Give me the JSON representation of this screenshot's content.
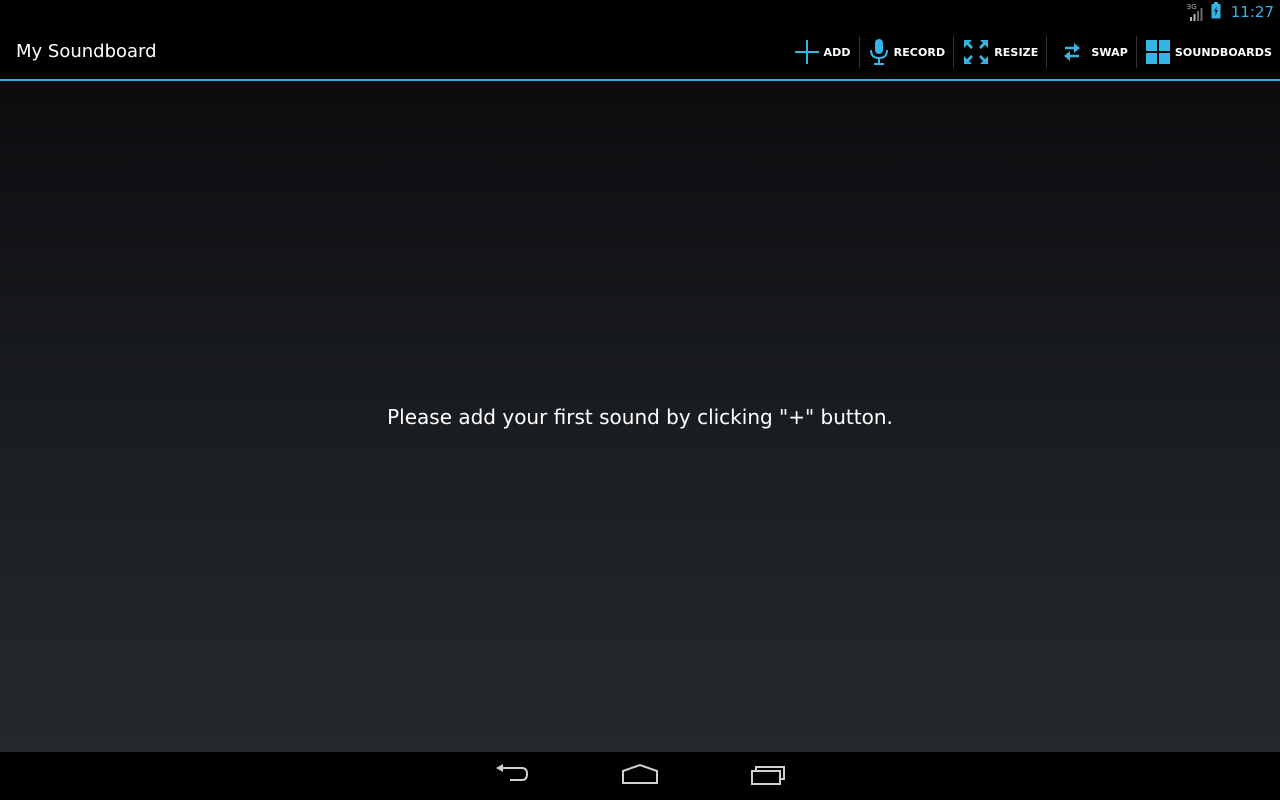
{
  "status_bar": {
    "network_type": "3G",
    "time": "11:27"
  },
  "action_bar": {
    "title": "My Soundboard",
    "actions": [
      {
        "label": "ADD",
        "icon": "plus-icon"
      },
      {
        "label": "RECORD",
        "icon": "microphone-icon"
      },
      {
        "label": "RESIZE",
        "icon": "resize-icon"
      },
      {
        "label": "SWAP",
        "icon": "swap-icon"
      },
      {
        "label": "SOUNDBOARDS",
        "icon": "grid-icon"
      }
    ]
  },
  "main": {
    "empty_message": "Please add your first sound by clicking \"+\" button."
  },
  "nav_bar": {
    "buttons": [
      "back-icon",
      "home-icon",
      "recent-apps-icon"
    ]
  },
  "colors": {
    "accent": "#33b5e5",
    "bar_background": "#000000",
    "text": "#ffffff"
  }
}
